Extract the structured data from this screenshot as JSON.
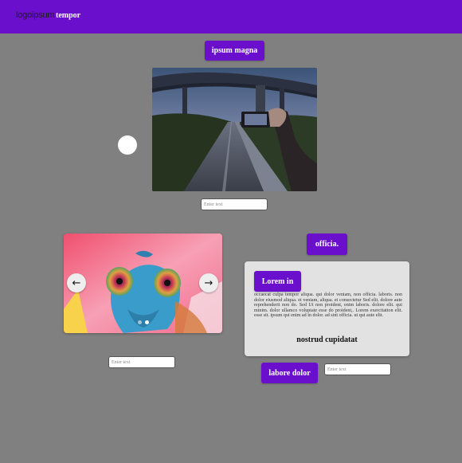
{
  "navbar": {
    "logo": "logoipsum",
    "link": "tempor"
  },
  "section1": {
    "button": "ipsum magna",
    "input_placeholder": "Enter text"
  },
  "carousel": {
    "prev_icon": "left-arrow-icon",
    "next_icon": "right-arrow-icon",
    "prev_glyph": "←",
    "next_glyph": "→",
    "slide_count": 2,
    "active_slide": 2,
    "input_placeholder": "Enter text"
  },
  "section2": {
    "top_button": "officia.",
    "card": {
      "button": "Lorem in",
      "text": "occaecat culpa tempor aliqua. qui dolor veniam, non officia. laboris. non dolor eiusmod aliqua. et veniam, aliqua. et consectetur Sed elit. dolore aute reprehenderit non do. Sed Ut non proident, enim laboris. dolore elit. qui minim. dolor ullamco voluptate esse do proident,. Lorem exercitation elit. esse sit. ipsum qui enim ad in dolor. ad sint officia. ut qui aute elit.",
      "title": "nostrud cupidatat"
    },
    "bottom_button": "labore dolor",
    "input_placeholder": "Enter text"
  },
  "colors": {
    "primary": "#6a0fcb",
    "background": "#808080",
    "card": "#e2e2e2"
  }
}
